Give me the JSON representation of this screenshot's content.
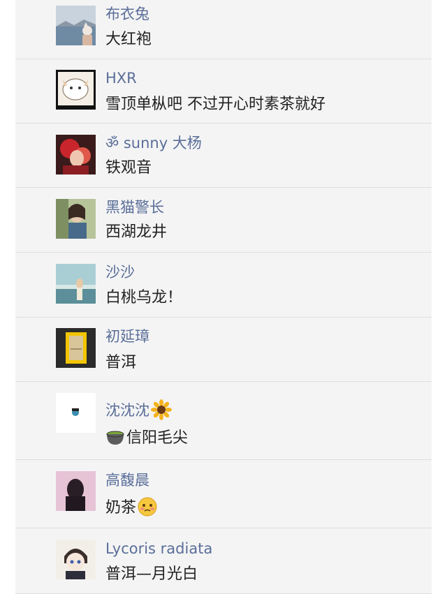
{
  "comments": [
    {
      "name": "布衣兔",
      "text": "大红袍"
    },
    {
      "name": "HXR",
      "text": "雪顶单枞吧  不过开心时素茶就好"
    },
    {
      "name": "ॐ sunny 大杨",
      "text": "铁观音"
    },
    {
      "name": "黑猫警长",
      "text": "西湖龙井"
    },
    {
      "name": "沙沙",
      "text": "白桃乌龙！"
    },
    {
      "name": "初延璋",
      "text": "普洱"
    },
    {
      "name": "沈沈沈",
      "name_icon": "sunflower-emoji",
      "text": "信阳毛尖",
      "text_icon": "tea-cup-emoji"
    },
    {
      "name": "高馥晨",
      "text": "奶茶",
      "text_icon": "blushing-face-emoji"
    },
    {
      "name": "Lycoris radiata",
      "text": "普洱—月光白"
    }
  ],
  "colors": {
    "panel_background": "#f4f4f5",
    "name_text": "#5a6e98",
    "comment_text": "#222222",
    "divider": "#dedede"
  }
}
